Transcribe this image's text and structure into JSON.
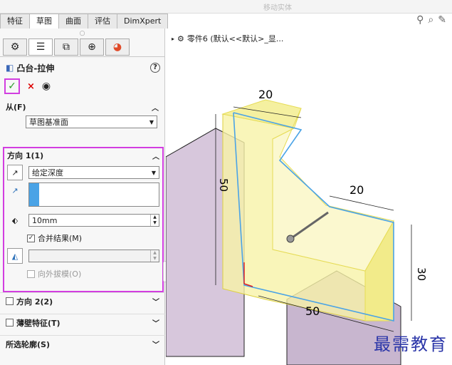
{
  "tabs": [
    "特征",
    "草图",
    "曲面",
    "评估",
    "DimXpert"
  ],
  "active_tab": "草图",
  "top_ghost_text": "移动实体",
  "view_tools": [
    "zoom-icon",
    "zoom-area-icon",
    "view-orient-icon"
  ],
  "property_manager": {
    "title": "凸台-拉伸",
    "help": "?",
    "ok_symbol": "✓",
    "cancel_symbol": "×",
    "from": {
      "label": "从(F)",
      "value": "草图基准面"
    },
    "direction1": {
      "label": "方向 1(1)",
      "end_condition": "给定深度",
      "direction_value": "",
      "depth": "10mm",
      "merge_label": "合并结果(M)",
      "merge_checked": true,
      "draft_value": "",
      "draft_outward_label": "向外拔模(O)",
      "draft_outward_checked": false
    },
    "direction2": {
      "label": "方向 2(2)"
    },
    "thin": {
      "label": "薄壁特征(T)"
    },
    "contours": {
      "label": "所选轮廓(S)"
    }
  },
  "feature_tree": {
    "item": "零件6 (默认<<默认>_显..."
  },
  "dimensions": [
    "20",
    "50",
    "20",
    "30",
    "50"
  ],
  "watermark": "最需教育",
  "colors": {
    "highlight": "#d23ee0",
    "preview_fill": "#f7f2a8",
    "edge_blue": "#4aa3e6",
    "wall": "#d7c7dc"
  }
}
